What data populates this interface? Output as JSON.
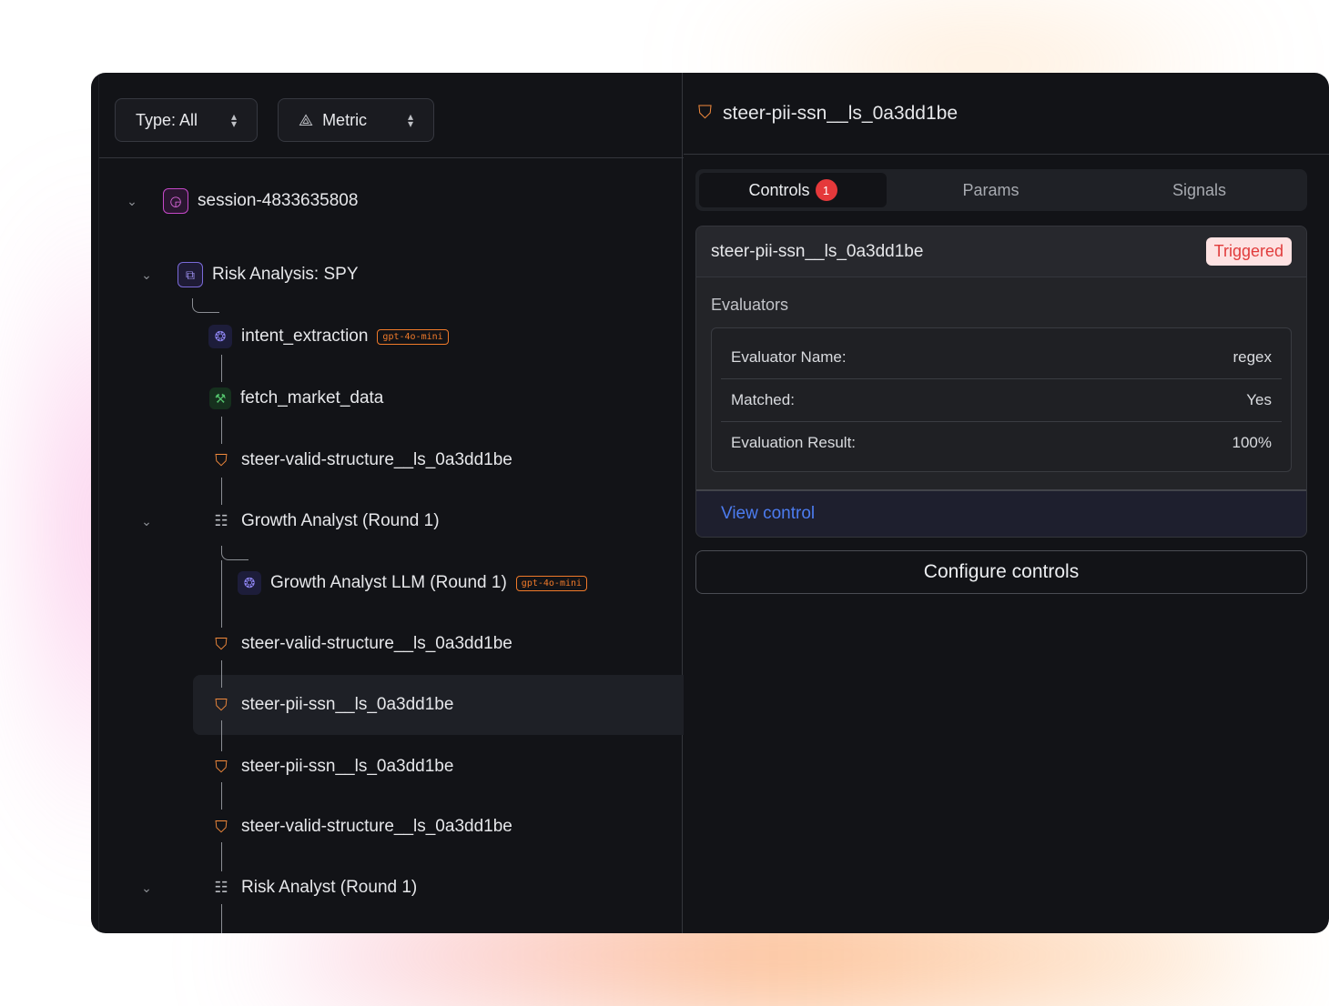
{
  "filters": {
    "type_label": "Type: All",
    "metric_label": "Metric"
  },
  "tree": {
    "session": "session-4833635808",
    "risk_analysis": "Risk Analysis: SPY",
    "intent_extraction": "intent_extraction",
    "intent_model": "gpt-4o-mini",
    "fetch_market_data": "fetch_market_data",
    "steer_valid_1": "steer-valid-structure__ls_0a3dd1be",
    "growth_analyst": "Growth Analyst (Round 1)",
    "growth_llm": "Growth Analyst LLM (Round 1)",
    "growth_llm_model": "gpt-4o-mini",
    "steer_valid_2": "steer-valid-structure__ls_0a3dd1be",
    "steer_pii_selected": "steer-pii-ssn__ls_0a3dd1be",
    "steer_pii_2": "steer-pii-ssn__ls_0a3dd1be",
    "steer_valid_3": "steer-valid-structure__ls_0a3dd1be",
    "risk_analyst": "Risk Analyst (Round 1)"
  },
  "detail": {
    "title": "steer-pii-ssn__ls_0a3dd1be",
    "tabs": {
      "controls": "Controls",
      "controls_count": "1",
      "params": "Params",
      "signals": "Signals"
    },
    "card": {
      "name": "steer-pii-ssn__ls_0a3dd1be",
      "status": "Triggered",
      "evaluators_heading": "Evaluators",
      "rows": [
        {
          "label": "Evaluator Name:",
          "value": "regex"
        },
        {
          "label": "Matched:",
          "value": "Yes"
        },
        {
          "label": "Evaluation Result:",
          "value": "100%"
        }
      ],
      "view_link": "View control"
    },
    "configure_label": "Configure controls"
  },
  "colors": {
    "accent_orange": "#f28a3c",
    "danger": "#e5393b",
    "link": "#4c7cf0"
  },
  "icons": [
    "session-icon",
    "agent-icon",
    "llm-brain-icon",
    "tool-wrench-icon",
    "shield-icon",
    "list-icon",
    "chevron-down-icon",
    "up-down-icon",
    "metric-icon"
  ]
}
